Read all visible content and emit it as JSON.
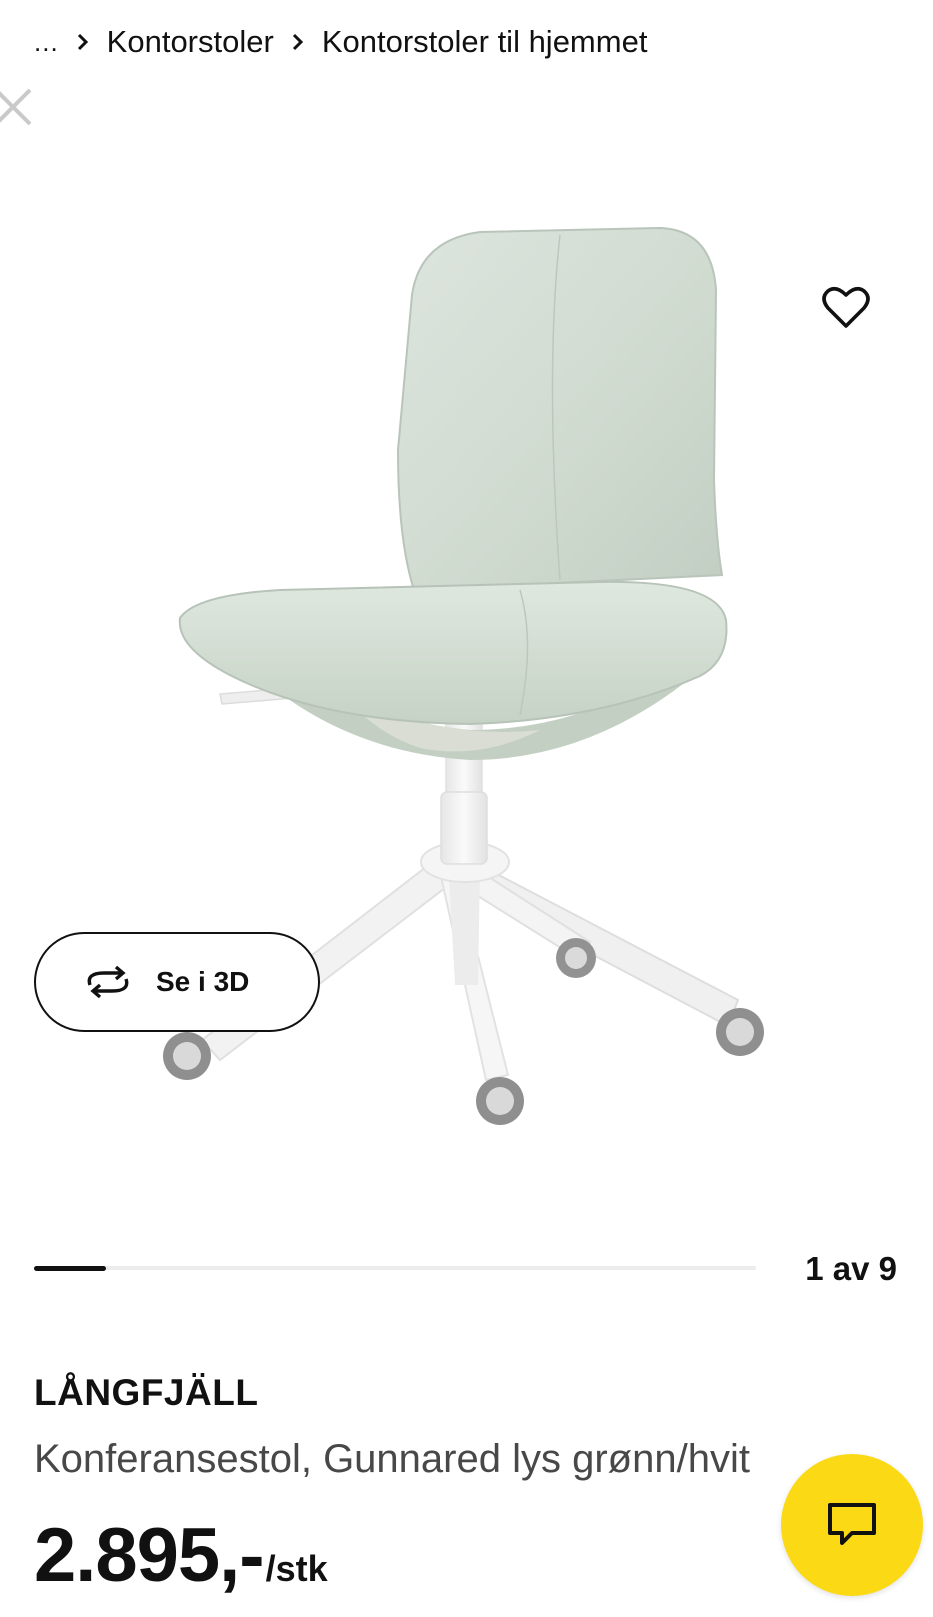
{
  "breadcrumb": {
    "ellipsis": "...",
    "items": [
      {
        "label": "Kontorstoler"
      },
      {
        "label": "Kontorstoler til hjemmet"
      }
    ]
  },
  "gallery": {
    "view_3d_label": "Se i 3D",
    "position_label": "1 av 9",
    "current": 1,
    "total": 9,
    "progress_fraction": 0.1
  },
  "product": {
    "name": "LÅNGFJÄLL",
    "description": "Konferansestol, Gunnared lys grønn/hvit",
    "price": "2.895,-",
    "price_unit": "/stk"
  },
  "icons": {
    "breadcrumb_separator": "chevron-right-icon",
    "close": "close-icon",
    "favourite": "heart-icon",
    "view_3d": "rotate-3d-icon",
    "chat": "chat-icon"
  },
  "colors": {
    "accent_yellow": "#fbd914",
    "text": "#111111",
    "secondary_text": "#484848",
    "seat_fabric": "#d3ddd4",
    "frame_white": "#f3f3f3"
  }
}
